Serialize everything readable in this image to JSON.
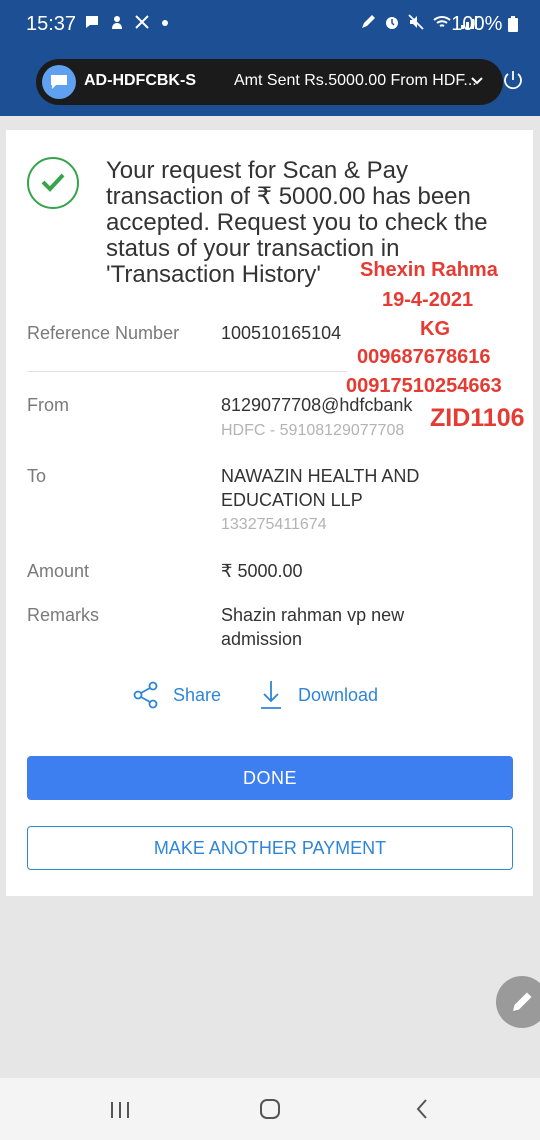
{
  "status_bar": {
    "time": "15:37",
    "battery": "100%",
    "icons_left": [
      "message-icon",
      "person-icon",
      "missed-call-icon",
      "dot-icon"
    ],
    "icons_right": [
      "pen-icon",
      "alarm-icon",
      "mute-icon",
      "wifi-icon",
      "signal-icon",
      "battery-icon"
    ]
  },
  "notification": {
    "sender": "AD-HDFCBK-S",
    "message": "Amt Sent Rs.5000.00 From HDF..."
  },
  "confirmation": {
    "message": "Your request for Scan & Pay transaction of ₹ 5000.00 has been accepted. Request you to check the status of your transaction in 'Transaction History'"
  },
  "details": {
    "reference_label": "Reference Number",
    "reference_value": "100510165104",
    "from_label": "From",
    "from_value": "8129077708@hdfcbank",
    "from_sub": "HDFC - 59108129077708",
    "to_label": "To",
    "to_line1": "NAWAZIN HEALTH AND",
    "to_line2": "EDUCATION LLP",
    "to_sub": "133275411674",
    "amount_label": "Amount",
    "amount_value": "₹ 5000.00",
    "remarks_label": "Remarks",
    "remarks_line1": "Shazin rahman vp new",
    "remarks_line2": "admission"
  },
  "overlay_text": {
    "name": "Shexin Rahma",
    "date": "19-4-2021",
    "grade": "KG",
    "phone1": "009687678616",
    "phone2": "00917510254663",
    "id": "ZID1106"
  },
  "actions": {
    "share_label": "Share",
    "download_label": "Download",
    "done_label": "DONE",
    "another_payment_label": "MAKE ANOTHER PAYMENT"
  },
  "colors": {
    "header": "#1c4f93",
    "success_green": "#37a34b",
    "primary_blue": "#3d7ff0",
    "link_blue": "#2f86d8",
    "overlay_red": "#e53b32"
  }
}
